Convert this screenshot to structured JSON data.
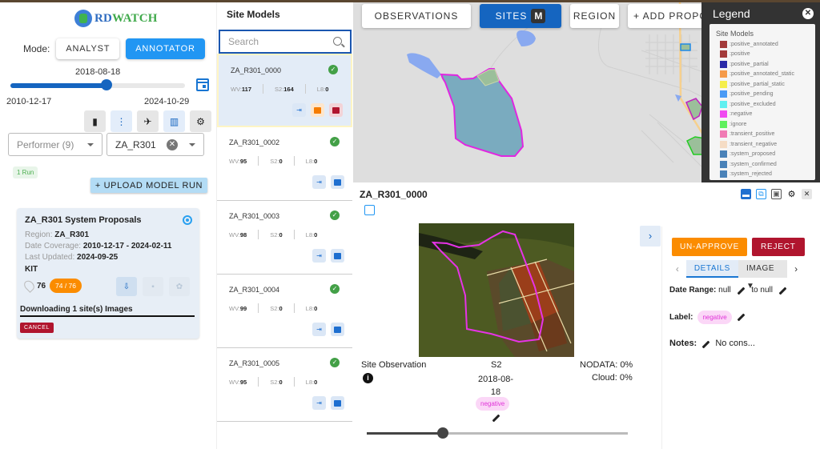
{
  "app": {
    "logo_prefix": "RD",
    "logo_suffix": "WATCH"
  },
  "mode": {
    "label": "Mode:",
    "options": [
      "ANALYST",
      "ANNOTATOR"
    ],
    "selected": "ANNOTATOR"
  },
  "timeline": {
    "current": "2018-08-18",
    "min": "2010-12-17",
    "max": "2024-10-29",
    "progress": 0.55
  },
  "filters": {
    "performer_placeholder": "Performer (9)",
    "region_value": "ZA_R301"
  },
  "runs": {
    "count_label": "1 Run",
    "upload_label": "+ UPLOAD MODEL RUN"
  },
  "model_run": {
    "title": "ZA_R301 System Proposals",
    "region_label": "Region:",
    "region": "ZA_R301",
    "coverage_label": "Date Coverage:",
    "coverage": "2010-12-17 - 2024-02-11",
    "updated_label": "Last Updated:",
    "updated": "2024-09-25",
    "performer": "KIT",
    "site_count": "76",
    "progress_badge": "74 / 76",
    "download_text": "Downloading 1 site(s) Images",
    "cancel_label": "CANCEL"
  },
  "site_models": {
    "title": "Site Models",
    "search_placeholder": "Search",
    "items": [
      {
        "name": "ZA_R301_0000",
        "wv_label": "WV:",
        "wv": "117",
        "s2_label": "S2:",
        "s2": "164",
        "l8_label": "L8:",
        "l8": "0",
        "selected": true
      },
      {
        "name": "ZA_R301_0002",
        "wv_label": "WV:",
        "wv": "95",
        "s2_label": "S2:",
        "s2": "0",
        "l8_label": "L8:",
        "l8": "0"
      },
      {
        "name": "ZA_R301_0003",
        "wv_label": "WV:",
        "wv": "98",
        "s2_label": "S2:",
        "s2": "0",
        "l8_label": "L8:",
        "l8": "0"
      },
      {
        "name": "ZA_R301_0004",
        "wv_label": "WV:",
        "wv": "99",
        "s2_label": "S2:",
        "s2": "0",
        "l8_label": "L8:",
        "l8": "0"
      },
      {
        "name": "ZA_R301_0005",
        "wv_label": "WV:",
        "wv": "95",
        "s2_label": "S2:",
        "s2": "0",
        "l8_label": "L8:",
        "l8": "0"
      }
    ]
  },
  "map_toolbar": {
    "observations": "OBSERVATIONS",
    "sites": "SITES",
    "sites_key": "M",
    "region": "REGION",
    "add_proposal": "+ ADD PROPOSAL"
  },
  "legend": {
    "title": "Legend",
    "section": "Site Models",
    "items": [
      {
        "label": ":positive_annotated",
        "color": "#a33a3a"
      },
      {
        "label": ":positive",
        "color": "#a33a3a"
      },
      {
        "label": ":positive_partial",
        "color": "#2a2aa8"
      },
      {
        "label": ":positive_annotated_static",
        "color": "#f59a4a"
      },
      {
        "label": ":positive_partial_static",
        "color": "#f5ee4a"
      },
      {
        "label": ":positive_pending",
        "color": "#4a9af5"
      },
      {
        "label": ":positive_excluded",
        "color": "#5ef0f0"
      },
      {
        "label": ":negative",
        "color": "#f04af0"
      },
      {
        "label": ":ignore",
        "color": "#5ef05e"
      },
      {
        "label": ":transient_positive",
        "color": "#f07ab4"
      },
      {
        "label": ":transient_negative",
        "color": "#f5dcc4"
      },
      {
        "label": ":system_proposed",
        "color": "#4a82b8"
      },
      {
        "label": ":system_confirmed",
        "color": "#4a82b8"
      },
      {
        "label": ":system_rejected",
        "color": "#4a82b8"
      }
    ]
  },
  "detail": {
    "title": "ZA_R301_0000",
    "observation_label": "Site Observation",
    "source": "S2",
    "date": "2018-08-18",
    "label": "negative",
    "nodata": "NODATA: 0%",
    "cloud": "Cloud: 0%",
    "slider_progress": 0.29,
    "unapprove_label": "UN-APPROVE",
    "reject_label": "REJECT",
    "tabs": [
      "DETAILS",
      "IMAGE"
    ],
    "date_range_label": "Date Range:",
    "date_start": "null",
    "to_label": "to null",
    "label_field": "Label:",
    "notes_label": "Notes:",
    "notes_value": "No cons..."
  }
}
